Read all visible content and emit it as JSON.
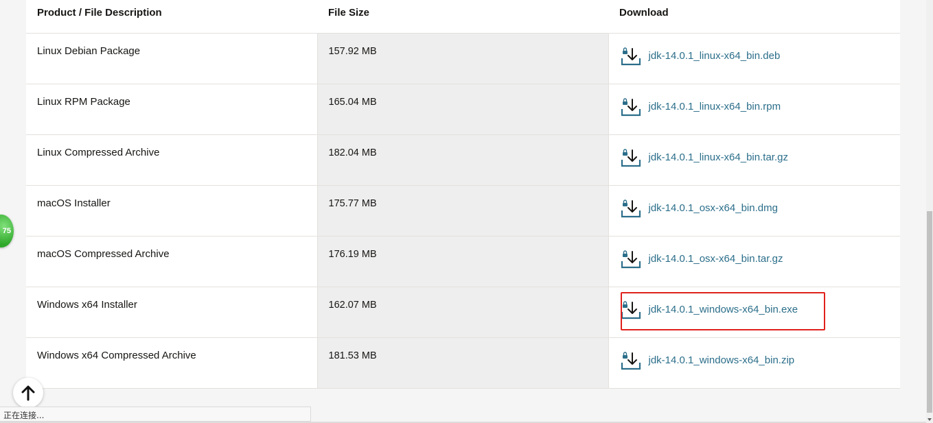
{
  "table": {
    "headers": {
      "description": "Product / File Description",
      "size": "File Size",
      "download": "Download"
    },
    "rows": [
      {
        "description": "Linux Debian Package",
        "size": "157.92 MB",
        "file": "jdk-14.0.1_linux-x64_bin.deb"
      },
      {
        "description": "Linux RPM Package",
        "size": "165.04 MB",
        "file": "jdk-14.0.1_linux-x64_bin.rpm"
      },
      {
        "description": "Linux Compressed Archive",
        "size": "182.04 MB",
        "file": "jdk-14.0.1_linux-x64_bin.tar.gz"
      },
      {
        "description": "macOS Installer",
        "size": "175.77 MB",
        "file": "jdk-14.0.1_osx-x64_bin.dmg"
      },
      {
        "description": "macOS Compressed Archive",
        "size": "176.19 MB",
        "file": "jdk-14.0.1_osx-x64_bin.tar.gz"
      },
      {
        "description": "Windows x64 Installer",
        "size": "162.07 MB",
        "file": "jdk-14.0.1_windows-x64_bin.exe",
        "highlighted": true
      },
      {
        "description": "Windows x64 Compressed Archive",
        "size": "181.53 MB",
        "file": "jdk-14.0.1_windows-x64_bin.zip"
      }
    ]
  },
  "badge": {
    "text": "75",
    "color": "#2fa82a"
  },
  "back_to_top": {
    "icon": "arrow-up-icon"
  },
  "status_bar": {
    "text": "正在连接..."
  },
  "colors": {
    "link": "#2b6e8a",
    "highlight_border": "#e0201b",
    "size_column_bg": "#eeeeee"
  }
}
